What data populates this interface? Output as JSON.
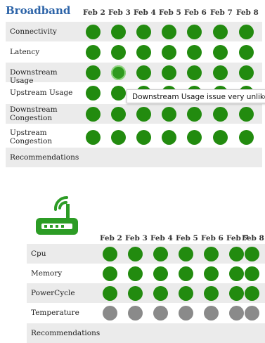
{
  "broadband": {
    "title": "Broadband",
    "dates": [
      "Feb 2",
      "Feb 3",
      "Feb 4",
      "Feb 5",
      "Feb 6",
      "Feb 7",
      "Feb 8"
    ],
    "rows": [
      {
        "label": "Connectivity",
        "status": [
          "green",
          "green",
          "green",
          "green",
          "green",
          "green",
          "green"
        ]
      },
      {
        "label": "Latency",
        "status": [
          "green",
          "green",
          "green",
          "green",
          "green",
          "green",
          "green"
        ]
      },
      {
        "label": "Downstream Usage",
        "status": [
          "green",
          "hover",
          "green",
          "green",
          "green",
          "green",
          "green"
        ]
      },
      {
        "label": "Upstream Usage",
        "status": [
          "green",
          "green",
          "green",
          "green",
          "green",
          "green",
          "green"
        ]
      },
      {
        "label": "Downstream Congestion",
        "status": [
          "green",
          "green",
          "green",
          "green",
          "green",
          "green",
          "green"
        ]
      },
      {
        "label": "Upstream Congestion",
        "status": [
          "green",
          "green",
          "green",
          "green",
          "green",
          "green",
          "green"
        ]
      }
    ],
    "recommendations_label": "Recommendations",
    "tooltip": "Downstream Usage issue very unlike"
  },
  "device": {
    "icon": "router-icon",
    "dates": [
      "Feb 2",
      "Feb 3",
      "Feb 4",
      "Feb 5",
      "Feb 6",
      "Feb 7",
      "Feb 8"
    ],
    "rows": [
      {
        "label": "Cpu",
        "status": [
          "green",
          "green",
          "green",
          "green",
          "green",
          "green",
          "green"
        ]
      },
      {
        "label": "Memory",
        "status": [
          "green",
          "green",
          "green",
          "green",
          "green",
          "green",
          "green"
        ]
      },
      {
        "label": "PowerCycle",
        "status": [
          "green",
          "green",
          "green",
          "green",
          "green",
          "green",
          "green"
        ]
      },
      {
        "label": "Temperature",
        "status": [
          "grey",
          "grey",
          "grey",
          "grey",
          "grey",
          "grey",
          "grey"
        ]
      }
    ],
    "recommendations_label": "Recommendations"
  },
  "colors": {
    "green": "#228b0f",
    "grey": "#8a8a8a",
    "title": "#2d64a8",
    "router": "#2c9c25"
  }
}
